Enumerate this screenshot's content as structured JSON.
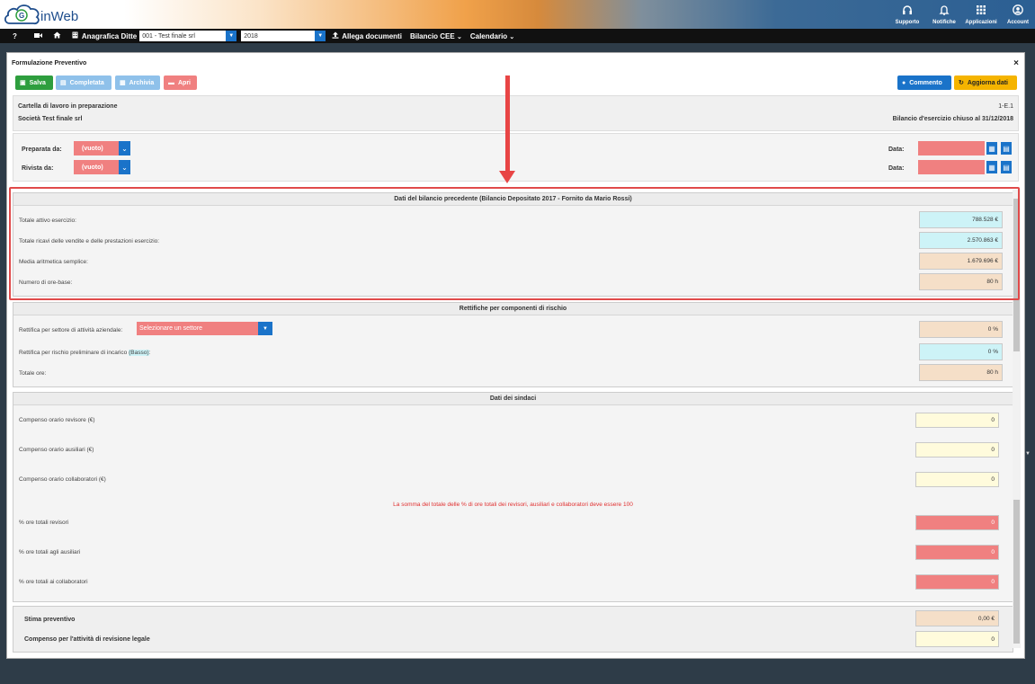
{
  "app": {
    "logo_text": "inWeb",
    "top_icons": [
      {
        "name": "headset-icon",
        "label": "Supporto"
      },
      {
        "name": "bell-icon",
        "label": "Notifiche"
      },
      {
        "name": "grid-icon",
        "label": "Applicazioni"
      },
      {
        "name": "user-icon",
        "label": "Account"
      }
    ]
  },
  "nav": {
    "help": "?",
    "anagrafica_label": "Anagrafica Ditte",
    "company_select": "001 - Test finale srl",
    "year_select": "2018",
    "allega": "Allega documenti",
    "bilancio": "Bilancio CEE",
    "calendario": "Calendario"
  },
  "panel": {
    "title": "Formulazione Preventivo",
    "close": "×",
    "buttons": {
      "salva": "Salva",
      "completata": "Completata",
      "archivia": "Archivia",
      "apri": "Apri",
      "commento": "Commento",
      "aggiorna": "Aggiorna dati"
    },
    "info": {
      "cartella": "Cartella di lavoro in preparazione",
      "societa": "Società Test finale srl",
      "code": "1-E.1",
      "bilancio": "Bilancio d'esercizio chiuso al 31/12/2018"
    },
    "prep": {
      "preparata_label": "Preparata da:",
      "preparata_value": "(vuoto)",
      "rivista_label": "Rivista da:",
      "rivista_value": "(vuoto)",
      "data_label": "Data:"
    },
    "dati_bilancio": {
      "title": "Dati del bilancio precedente (Bilancio Depositato 2017 - Fornito da Mario Rossi)",
      "rows": [
        {
          "label": "Totale attivo esercizio:",
          "value": "788.528 €"
        },
        {
          "label": "Totale ricavi delle vendite e delle prestazioni esercizio:",
          "value": "2.570.863 €"
        },
        {
          "label": "Media aritmetica semplice:",
          "value": "1.679.696 €"
        },
        {
          "label": "Numero di ore-base:",
          "value": "80 h"
        }
      ]
    },
    "rettifiche": {
      "title": "Rettifiche per componenti di rischio",
      "settore_label": "Rettifica per settore di attività aziendale:",
      "settore_select": "Selezionare un settore",
      "settore_value": "0 %",
      "rischio_label": "Rettifica per rischio preliminare di incarico",
      "rischio_badge": "(Basso)",
      "rischio_colon": ":",
      "rischio_value": "0 %",
      "totale_label": "Totale ore:",
      "totale_value": "80 h"
    },
    "sindaci": {
      "title": "Dati dei sindaci",
      "rows": [
        {
          "label": "Compenso orario revisore (€)",
          "value": "0"
        },
        {
          "label": "Compenso orario ausiliari (€)",
          "value": "0"
        },
        {
          "label": "Compenso orario collaboratori (€)",
          "value": "0"
        }
      ],
      "warning": "La somma del totale delle % di ore totali dei revisori, ausiliari e collaboratori deve essere 100",
      "perc_rows": [
        {
          "label": "% ore totali revisori",
          "value": "0"
        },
        {
          "label": "% ore totali agli ausiliari",
          "value": "0"
        },
        {
          "label": "% ore totali ai collaboratori",
          "value": "0"
        }
      ]
    },
    "stima": {
      "label": "Stima preventivo",
      "value": "0,00 €",
      "compenso_label": "Compenso per l'attività di revisione legale",
      "compenso_value": "0"
    }
  },
  "colors": {
    "accent_red": "#e84545",
    "primary_blue": "#1a73c9",
    "save_green": "#2e9e3e",
    "warning_orange": "#f5b400"
  }
}
